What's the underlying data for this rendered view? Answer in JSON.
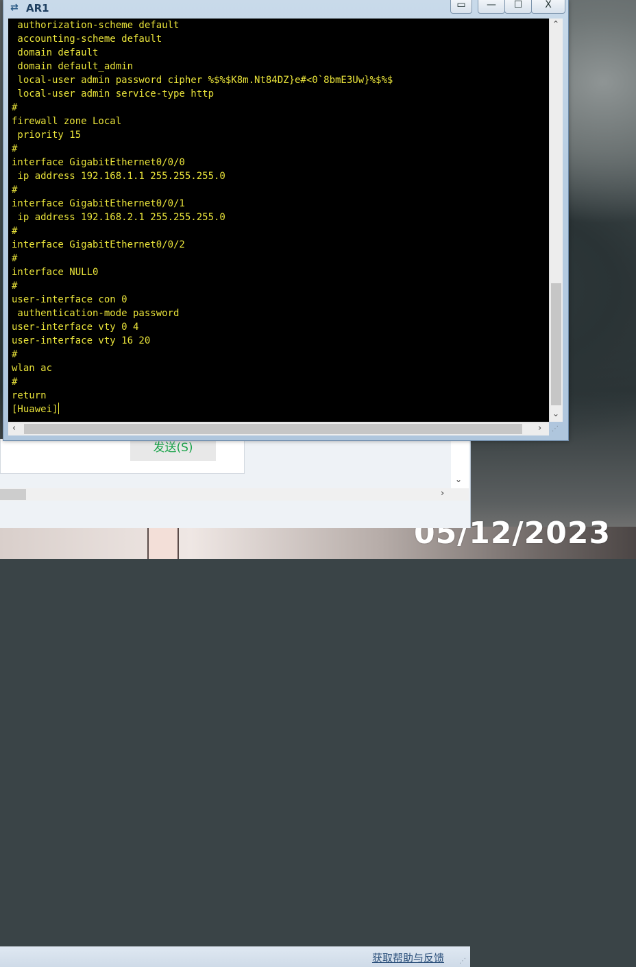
{
  "terminal": {
    "title": "AR1",
    "icon": "network-device-icon",
    "title_buttons": {
      "extra": "▭",
      "minimize": "—",
      "maximize": "☐",
      "close": "X"
    },
    "lines": [
      " authorization-scheme default",
      " accounting-scheme default",
      " domain default",
      " domain default_admin",
      " local-user admin password cipher %$%$K8m.Nt84DZ}e#<0`8bmE3Uw}%$%$",
      " local-user admin service-type http",
      "#",
      "firewall zone Local",
      " priority 15",
      "#",
      "interface GigabitEthernet0/0/0",
      " ip address 192.168.1.1 255.255.255.0",
      "#",
      "interface GigabitEthernet0/0/1",
      " ip address 192.168.2.1 255.255.255.0",
      "#",
      "interface GigabitEthernet0/0/2",
      "#",
      "interface NULL0",
      "#",
      "user-interface con 0",
      " authentication-mode password",
      "user-interface vty 0 4",
      "user-interface vty 16 20",
      "#",
      "wlan ac",
      "#",
      "return",
      "[Huawei]"
    ],
    "text_color": "#e9e33a",
    "background_color": "#000000"
  },
  "background_window": {
    "send_button": "发送(S)",
    "help_link": "获取帮助与反馈"
  },
  "desktop": {
    "date_overlay": "05/12/2023"
  }
}
